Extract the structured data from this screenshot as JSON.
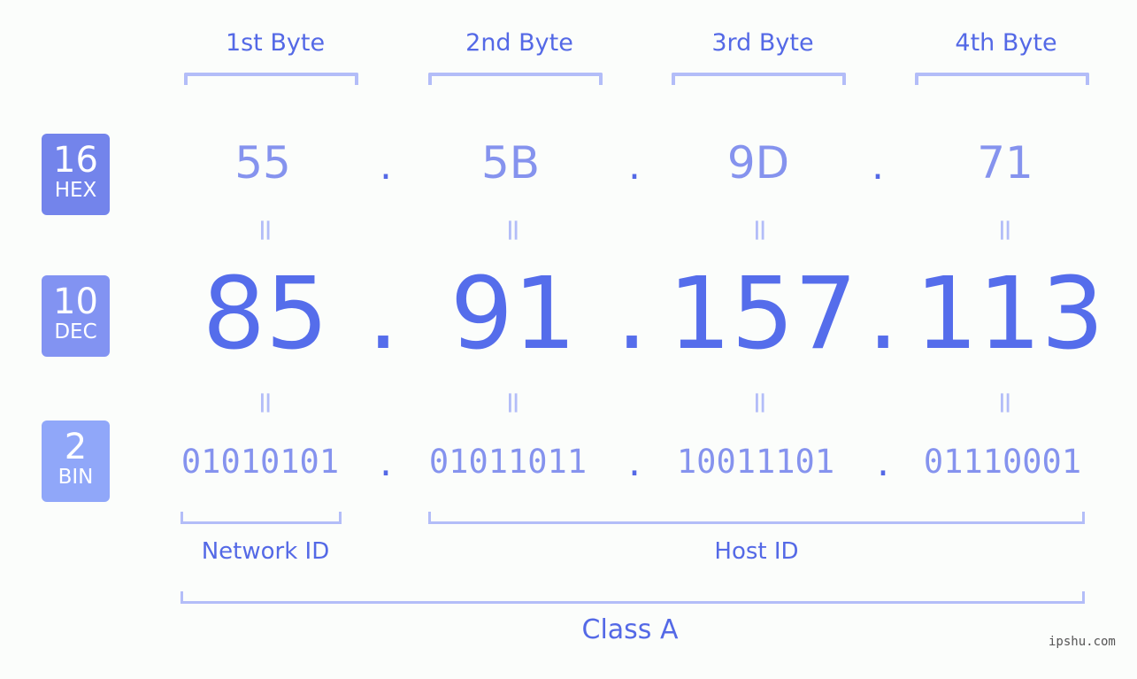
{
  "bytes": [
    {
      "label": "1st Byte",
      "hex": "55",
      "dec": "85",
      "bin": "01010101"
    },
    {
      "label": "2nd Byte",
      "hex": "5B",
      "dec": "91",
      "bin": "01011011"
    },
    {
      "label": "3rd Byte",
      "hex": "9D",
      "dec": "157",
      "bin": "10011101"
    },
    {
      "label": "4th Byte",
      "hex": "71",
      "dec": "113",
      "bin": "01110001"
    }
  ],
  "separator": ".",
  "equals": "=",
  "badges": {
    "hex": {
      "num": "16",
      "label": "HEX",
      "color": "#7384eb"
    },
    "dec": {
      "num": "10",
      "label": "DEC",
      "color": "#8293f2"
    },
    "bin": {
      "num": "2",
      "label": "BIN",
      "color": "#90a7f9"
    }
  },
  "segments": {
    "network": "Network ID",
    "host": "Host ID",
    "class": "Class A"
  },
  "watermark": "ipshu.com",
  "colors": {
    "primary": "#556deb",
    "light": "#8593ee",
    "bracket": "#b3bdf8",
    "background": "#fbfdfb"
  }
}
